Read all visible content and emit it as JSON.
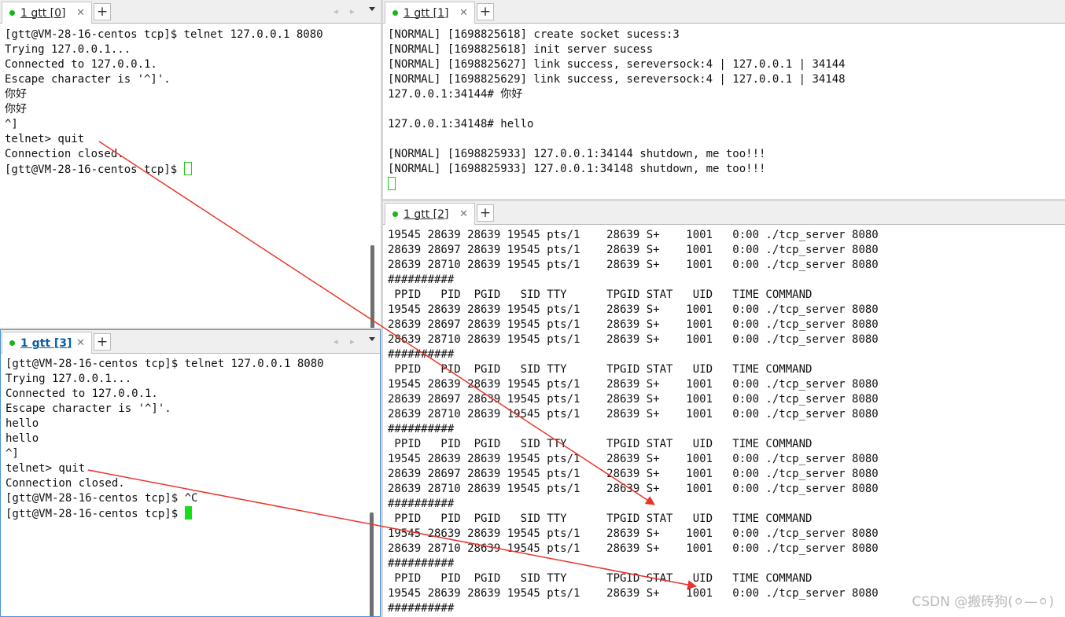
{
  "panes": {
    "p0": {
      "tab_label": "1 gtt [0]",
      "lines": [
        "[gtt@VM-28-16-centos tcp]$ telnet 127.0.0.1 8080",
        "Trying 127.0.0.1...",
        "Connected to 127.0.0.1.",
        "Escape character is '^]'.",
        "你好",
        "你好",
        "^]",
        "telnet> quit",
        "Connection closed.",
        "[gtt@VM-28-16-centos tcp]$ "
      ]
    },
    "p1": {
      "tab_label": "1 gtt [1]",
      "lines": [
        "[NORMAL] [1698825618] create socket sucess:3",
        "[NORMAL] [1698825618] init server sucess",
        "[NORMAL] [1698825627] link success, sereversock:4 | 127.0.0.1 | 34144",
        "[NORMAL] [1698825629] link success, sereversock:4 | 127.0.0.1 | 34148",
        "127.0.0.1:34144# 你好",
        "",
        "127.0.0.1:34148# hello",
        "",
        "[NORMAL] [1698825933] 127.0.0.1:34144 shutdown, me too!!!",
        "[NORMAL] [1698825933] 127.0.0.1:34148 shutdown, me too!!!",
        ""
      ]
    },
    "p2": {
      "tab_label": "1 gtt [2]",
      "lines": [
        "19545 28639 28639 19545 pts/1    28639 S+    1001   0:00 ./tcp_server 8080",
        "28639 28697 28639 19545 pts/1    28639 S+    1001   0:00 ./tcp_server 8080",
        "28639 28710 28639 19545 pts/1    28639 S+    1001   0:00 ./tcp_server 8080",
        "##########",
        " PPID   PID  PGID   SID TTY      TPGID STAT   UID   TIME COMMAND",
        "19545 28639 28639 19545 pts/1    28639 S+    1001   0:00 ./tcp_server 8080",
        "28639 28697 28639 19545 pts/1    28639 S+    1001   0:00 ./tcp_server 8080",
        "28639 28710 28639 19545 pts/1    28639 S+    1001   0:00 ./tcp_server 8080",
        "##########",
        " PPID   PID  PGID   SID TTY      TPGID STAT   UID   TIME COMMAND",
        "19545 28639 28639 19545 pts/1    28639 S+    1001   0:00 ./tcp_server 8080",
        "28639 28697 28639 19545 pts/1    28639 S+    1001   0:00 ./tcp_server 8080",
        "28639 28710 28639 19545 pts/1    28639 S+    1001   0:00 ./tcp_server 8080",
        "##########",
        " PPID   PID  PGID   SID TTY      TPGID STAT   UID   TIME COMMAND",
        "19545 28639 28639 19545 pts/1    28639 S+    1001   0:00 ./tcp_server 8080",
        "28639 28697 28639 19545 pts/1    28639 S+    1001   0:00 ./tcp_server 8080",
        "28639 28710 28639 19545 pts/1    28639 S+    1001   0:00 ./tcp_server 8080",
        "##########",
        " PPID   PID  PGID   SID TTY      TPGID STAT   UID   TIME COMMAND",
        "19545 28639 28639 19545 pts/1    28639 S+    1001   0:00 ./tcp_server 8080",
        "28639 28710 28639 19545 pts/1    28639 S+    1001   0:00 ./tcp_server 8080",
        "##########",
        " PPID   PID  PGID   SID TTY      TPGID STAT   UID   TIME COMMAND",
        "19545 28639 28639 19545 pts/1    28639 S+    1001   0:00 ./tcp_server 8080",
        "##########"
      ]
    },
    "p3": {
      "tab_label": "1 gtt [3]",
      "lines": [
        "[gtt@VM-28-16-centos tcp]$ telnet 127.0.0.1 8080",
        "Trying 127.0.0.1...",
        "Connected to 127.0.0.1.",
        "Escape character is '^]'.",
        "hello",
        "hello",
        "^]",
        "telnet> quit",
        "Connection closed.",
        "[gtt@VM-28-16-centos tcp]$ ^C",
        "[gtt@VM-28-16-centos tcp]$ "
      ]
    }
  },
  "tab_controls": {
    "close_glyph": "✕",
    "add_glyph": "+",
    "nav_glyph": "◂ ▸"
  },
  "watermark": "CSDN @搬砖狗(⚪—⚪)",
  "colors": {
    "cursor": "#19dd19",
    "annotation_arrow": "#e8352c",
    "focused_tab_text": "#0b5fa5",
    "status_dot": "#19b419"
  }
}
